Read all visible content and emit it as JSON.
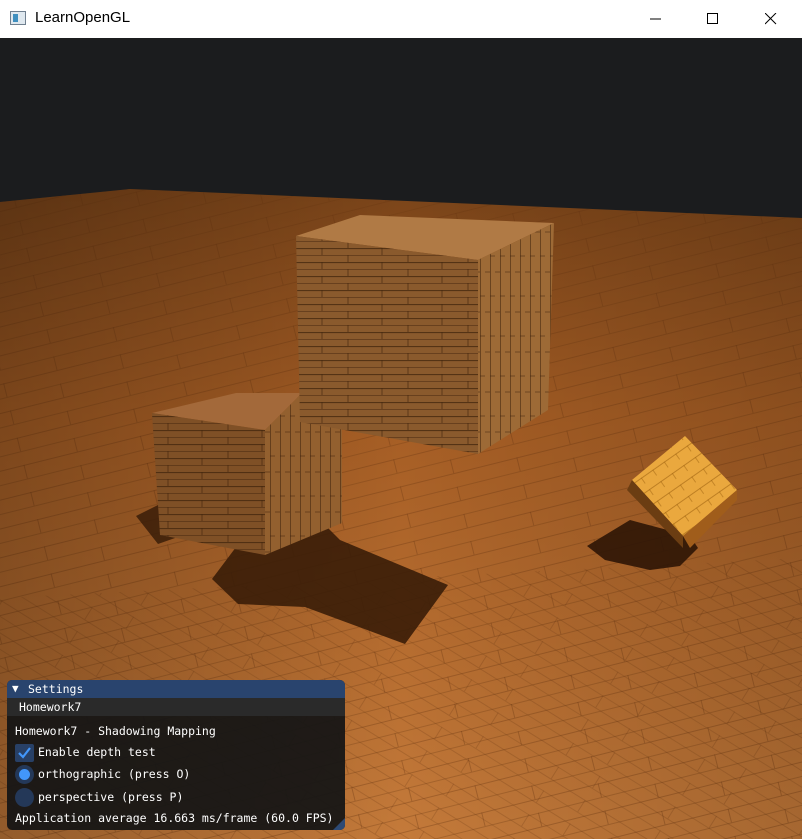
{
  "window": {
    "title": "LearnOpenGL",
    "icon": "opengl-app-icon",
    "controls": {
      "minimize_icon": "minimize-icon",
      "maximize_icon": "maximize-icon",
      "close_icon": "close-icon"
    }
  },
  "scene": {
    "clear_color": "#1b1c1e",
    "floor_color": "#b86a2a",
    "box_color": "#9a6431",
    "lit_box_color": "#e9a33d",
    "shadow_color": "#3a1d08"
  },
  "settings_panel": {
    "title": "Settings",
    "collapse_icon": "triangle-down-icon",
    "tab": "Homework7",
    "heading": "Homework7 - Shadowing Mapping",
    "depth_test": {
      "label": "Enable depth test",
      "checked": true
    },
    "projection_options": [
      {
        "label": "orthographic (press O)",
        "selected": true
      },
      {
        "label": "perspective (press P)",
        "selected": false
      }
    ],
    "fps_text": "Application average 16.663 ms/frame (60.0 FPS)",
    "accent_color": "#4296fa",
    "title_color": "#29446e"
  }
}
